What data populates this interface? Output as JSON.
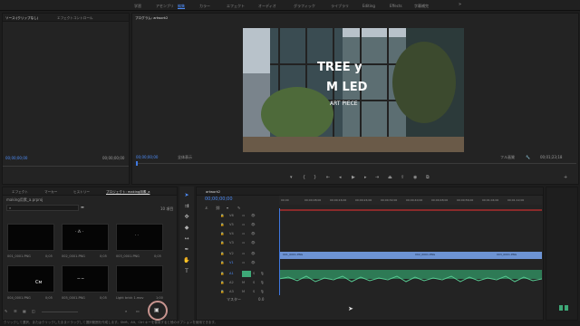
{
  "workspaces": [
    "学習",
    "アセンブリ",
    "編集",
    "カラー",
    "エフェクト",
    "オーディオ",
    "グラフィック",
    "ライブラリ",
    "Editing",
    "Effects",
    "字幕補完"
  ],
  "active_workspace_index": 2,
  "source_panel": {
    "tabs": [
      "ソース:(クリップなし)",
      "エフェクトコントロール"
    ],
    "timecode_left": "00;00;00;00",
    "timecode_right": "00;00;00;00"
  },
  "program": {
    "tab": "プログラム: artwork2",
    "timecode": "00;00;00;00",
    "fit": "全体表示",
    "quality": "フル画質",
    "duration": "00;01;23;18",
    "overlay_line1": "TREE y",
    "overlay_line2": "M LED",
    "overlay_line3": "ART PIECE"
  },
  "project": {
    "tabs": [
      "エフェクト",
      "マーカー",
      "ヒストリー",
      "プロジェクト: making用素_a"
    ],
    "name": "making用素_a.prproj",
    "count": "10 項目",
    "search_placeholder": "",
    "items": [
      {
        "name": "001_0001.PNG",
        "dur": "0;05"
      },
      {
        "name": "002_0001.PNG",
        "dur": "0;05"
      },
      {
        "name": "003_0001.PNG",
        "dur": "0;05"
      },
      {
        "name": "004_0001.PNG",
        "dur": "0;05"
      },
      {
        "name": "005_0001.PNG",
        "dur": "0;05"
      },
      {
        "name": "Light brick 1.mov",
        "dur": "1;00"
      }
    ]
  },
  "timeline": {
    "tab": "artwork2",
    "timecode": "00;00;00;00",
    "rulers": [
      "00;00",
      "00;00;08;00",
      "00;00;16;00",
      "00;00;24;00",
      "00;00;32;00",
      "00;00;40;00",
      "00;00;48;00",
      "00;00;56;00",
      "00;01;04;00",
      "00;01;12;00"
    ],
    "video_tracks": [
      "V6",
      "V5",
      "V4",
      "V3",
      "V2",
      "V1"
    ],
    "audio_tracks": [
      "A1",
      "A2",
      "A3"
    ],
    "master": "マスター",
    "master_val": "0.0",
    "clips": [
      "001_0001.PNG",
      "002_0001.PNG",
      "003_0001.PNG"
    ]
  },
  "status": "クリックして選択、またはクリックしたままドラッグして選択範囲を作成します。Shift、Alt、Ctrl キーを使用すると他のオプションを使用できます。",
  "colors": {
    "accent": "#4d8bf5",
    "video_clip": "#6d93d3",
    "audio_clip": "#3ea877",
    "playhead": "#3f78e0"
  }
}
